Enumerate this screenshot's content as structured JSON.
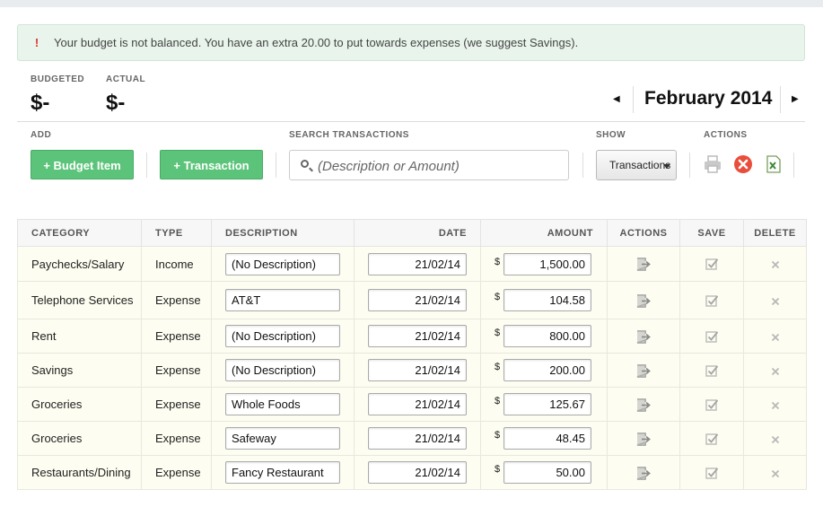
{
  "alert": {
    "icon": "warning-icon",
    "message": "Your budget is not balanced. You have an extra 20.00 to put towards expenses (we suggest Savings)."
  },
  "summary": {
    "budgeted_label": "BUDGETED",
    "budgeted_value": "$-",
    "actual_label": "ACTUAL",
    "actual_value": "$-"
  },
  "month": {
    "title": "February 2014",
    "prev_icon": "triangle-left-icon",
    "next_icon": "triangle-right-icon"
  },
  "toolbar": {
    "add_label": "ADD",
    "add_budget_item": "+ Budget Item",
    "add_transaction": "+ Transaction",
    "search_label": "SEARCH TRANSACTIONS",
    "search_placeholder": "(Description or Amount)",
    "show_label": "SHOW",
    "show_selected": "Transactions",
    "actions_label": "ACTIONS",
    "action_icons": [
      "print-icon",
      "cancel-icon",
      "excel-export-icon"
    ]
  },
  "colors": {
    "accent_green": "#5cc47a",
    "alert_bg": "#e9f5ec",
    "cancel_red": "#e94e3c",
    "row_bg": "#fdfdf1"
  },
  "table": {
    "headers": [
      "CATEGORY",
      "TYPE",
      "DESCRIPTION",
      "DATE",
      "AMOUNT",
      "ACTIONS",
      "SAVE",
      "DELETE"
    ],
    "currency_symbol": "$",
    "rows": [
      {
        "category": "Paychecks/Salary",
        "type": "Income",
        "description": "(No Description)",
        "date": "21/02/14",
        "amount": "1,500.00"
      },
      {
        "category": "Telephone Services",
        "type": "Expense",
        "description": "AT&T",
        "date": "21/02/14",
        "amount": "104.58"
      },
      {
        "category": "Rent",
        "type": "Expense",
        "description": "(No Description)",
        "date": "21/02/14",
        "amount": "800.00"
      },
      {
        "category": "Savings",
        "type": "Expense",
        "description": "(No Description)",
        "date": "21/02/14",
        "amount": "200.00"
      },
      {
        "category": "Groceries",
        "type": "Expense",
        "description": "Whole Foods",
        "date": "21/02/14",
        "amount": "125.67"
      },
      {
        "category": "Groceries",
        "type": "Expense",
        "description": "Safeway",
        "date": "21/02/14",
        "amount": "48.45"
      },
      {
        "category": "Restaurants/Dining",
        "type": "Expense",
        "description": "Fancy Restaurant",
        "date": "21/02/14",
        "amount": "50.00"
      }
    ],
    "row_icons": {
      "action": "export-arrow-icon",
      "save": "checkbox-check-icon",
      "delete": "close-icon"
    }
  }
}
